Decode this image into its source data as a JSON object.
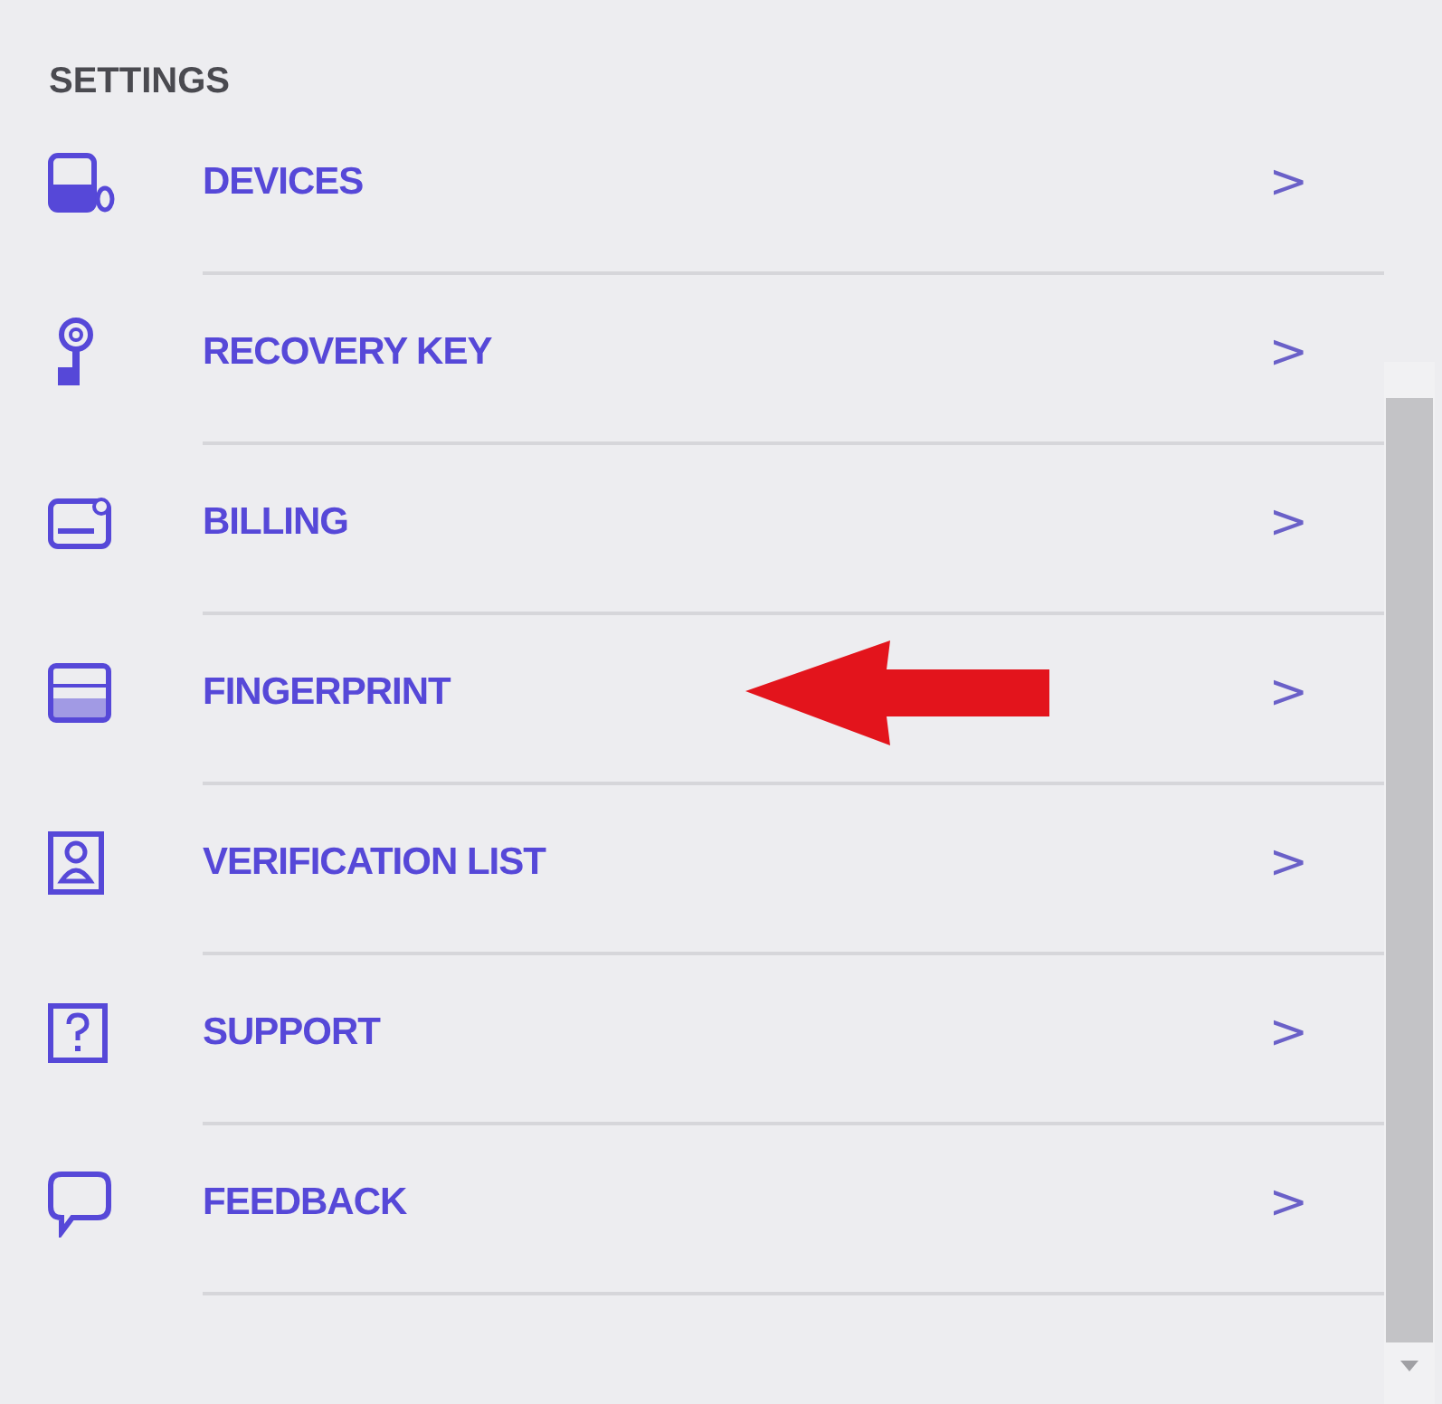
{
  "header": "SETTINGS",
  "items": [
    {
      "label": "DEVICES",
      "chevron": ">",
      "annotated": false
    },
    {
      "label": "RECOVERY KEY",
      "chevron": ">",
      "annotated": false
    },
    {
      "label": "BILLING",
      "chevron": ">",
      "annotated": false
    },
    {
      "label": "FINGERPRINT",
      "chevron": ">",
      "annotated": true
    },
    {
      "label": "VERIFICATION LIST",
      "chevron": ">",
      "annotated": false
    },
    {
      "label": "SUPPORT",
      "chevron": ">",
      "annotated": false
    },
    {
      "label": "FEEDBACK",
      "chevron": ">",
      "annotated": false
    }
  ]
}
